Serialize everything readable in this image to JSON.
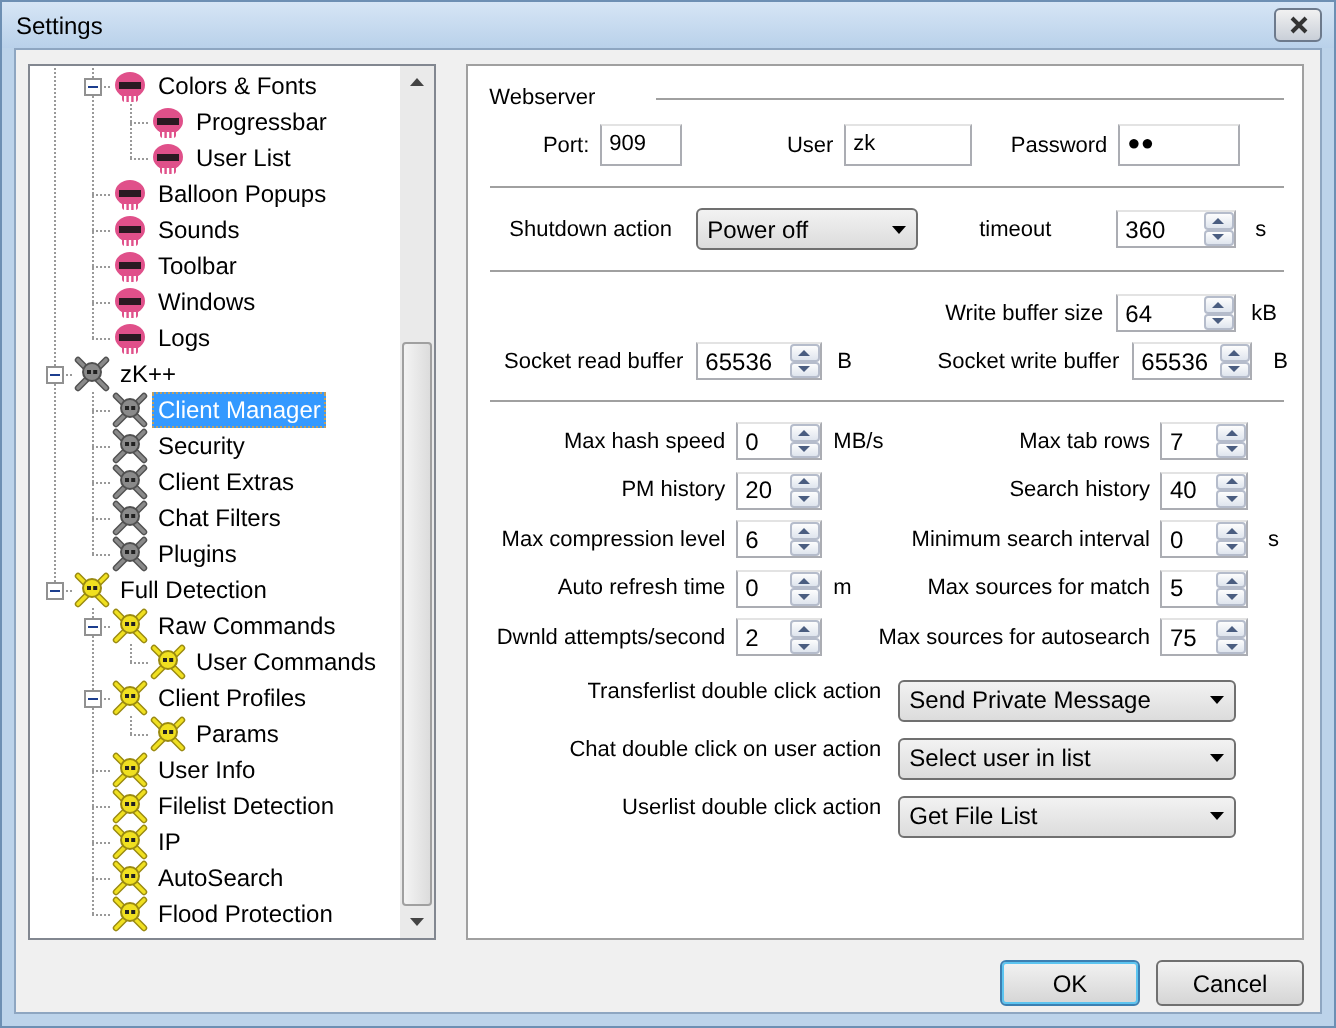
{
  "window": {
    "title": "Settings"
  },
  "tree": {
    "items": [
      {
        "children": [
          {
            "label": "Colors & Fonts",
            "kind": "pink-skull",
            "expanded": true,
            "selected": false,
            "children": [
              {
                "label": "Progressbar",
                "kind": "pink-skull",
                "selected": false
              },
              {
                "label": "User List",
                "kind": "pink-skull",
                "selected": false
              }
            ]
          },
          {
            "label": "Balloon Popups",
            "kind": "pink-skull",
            "selected": false
          },
          {
            "label": "Sounds",
            "kind": "pink-skull",
            "selected": false
          },
          {
            "label": "Toolbar",
            "kind": "pink-skull",
            "selected": false
          },
          {
            "label": "Windows",
            "kind": "pink-skull",
            "selected": false
          },
          {
            "label": "Logs",
            "kind": "pink-skull",
            "selected": false
          }
        ]
      },
      {
        "label": "zK++",
        "kind": "grey-crossbones",
        "expanded": true,
        "selected": false,
        "children": [
          {
            "label": "Client Manager",
            "kind": "grey-crossbones",
            "selected": true
          },
          {
            "label": "Security",
            "kind": "grey-crossbones",
            "selected": false
          },
          {
            "label": "Client Extras",
            "kind": "grey-crossbones",
            "selected": false
          },
          {
            "label": "Chat Filters",
            "kind": "grey-crossbones",
            "selected": false
          },
          {
            "label": "Plugins",
            "kind": "grey-crossbones",
            "selected": false
          }
        ]
      },
      {
        "label": "Full Detection",
        "kind": "yellow-crossbones",
        "expanded": true,
        "selected": false,
        "children": [
          {
            "label": "Raw Commands",
            "kind": "yellow-crossbones",
            "expanded": true,
            "selected": false,
            "children": [
              {
                "label": "User Commands",
                "kind": "yellow-crossbones",
                "selected": false
              }
            ]
          },
          {
            "label": "Client Profiles",
            "kind": "yellow-crossbones",
            "expanded": true,
            "selected": false,
            "children": [
              {
                "label": "Params",
                "kind": "yellow-crossbones",
                "selected": false
              }
            ]
          },
          {
            "label": "User Info",
            "kind": "yellow-crossbones",
            "selected": false
          },
          {
            "label": "Filelist Detection",
            "kind": "yellow-crossbones",
            "selected": false
          },
          {
            "label": "IP",
            "kind": "yellow-crossbones",
            "selected": false
          },
          {
            "label": "AutoSearch",
            "kind": "yellow-crossbones",
            "selected": false
          },
          {
            "label": "Flood Protection",
            "kind": "yellow-crossbones",
            "selected": false
          }
        ]
      }
    ]
  },
  "webserver": {
    "title": "Webserver",
    "fields": [
      {
        "label": "Port:",
        "value": "909"
      },
      {
        "label": "User",
        "value": "zk"
      },
      {
        "label": "Password",
        "value": "●●"
      }
    ]
  },
  "shutdown": {
    "label": "Shutdown action",
    "value": "Power off",
    "timeout_label": "timeout",
    "timeout": "360",
    "unit": "s"
  },
  "buffers": {
    "write_label": "Write buffer size",
    "write_size": "64",
    "write_unit": "kB",
    "read_label": "Socket read buffer",
    "read": "65536",
    "read_unit": "B",
    "socket_write_label": "Socket write buffer",
    "socket_write": "65536",
    "socket_write_unit": "B"
  },
  "limits": [
    {
      "left": {
        "label": "Max hash speed",
        "value": "0",
        "unit": "MB/s"
      },
      "right": {
        "label": "Max tab rows",
        "value": "7"
      }
    },
    {
      "left": {
        "label": "PM history",
        "value": "20"
      },
      "right": {
        "label": "Search history",
        "value": "40"
      }
    },
    {
      "left": {
        "label": "Max compression level",
        "value": "6"
      },
      "right": {
        "label": "Minimum search interval",
        "value": "0",
        "unit": "s"
      }
    },
    {
      "left": {
        "label": "Auto refresh time",
        "value": "0",
        "unit": "m"
      },
      "right": {
        "label": "Max sources for match",
        "value": "5"
      }
    },
    {
      "left": {
        "label": "Dwnld attempts/second",
        "value": "2"
      },
      "right": {
        "label": "Max sources for autosearch",
        "value": "75"
      }
    }
  ],
  "actions": [
    {
      "label": "Transferlist double click action",
      "value": "Send Private Message"
    },
    {
      "label": "Chat double click on user action",
      "value": "Select user in list"
    },
    {
      "label": "Userlist double click action",
      "value": "Get File List"
    }
  ],
  "buttons": [
    {
      "label": "OK",
      "default": true
    },
    {
      "label": "Cancel",
      "default": false
    }
  ]
}
